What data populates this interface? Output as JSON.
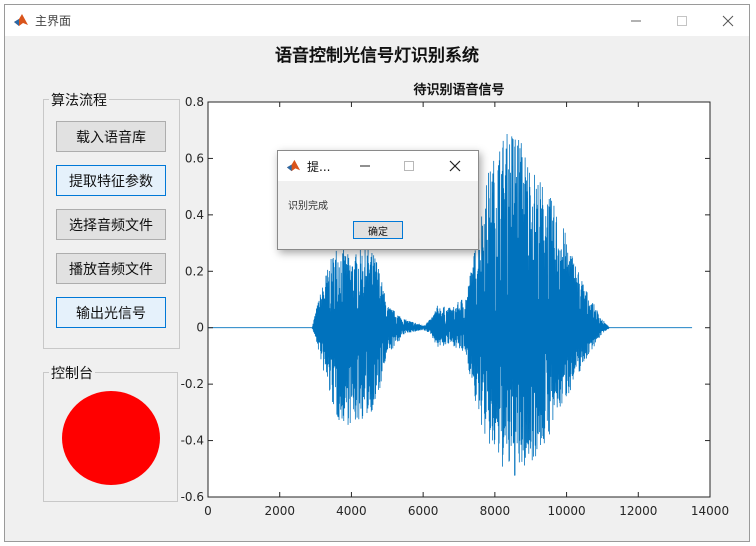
{
  "window": {
    "title": "主界面",
    "icon": "matlab-icon",
    "controls": [
      "minimize-icon",
      "maximize-icon",
      "close-icon"
    ]
  },
  "app": {
    "title": "语音控制光信号灯识别系统"
  },
  "algorithm_panel": {
    "title": "算法流程",
    "buttons": [
      {
        "label": "载入语音库",
        "highlighted": false
      },
      {
        "label": "提取特征参数",
        "highlighted": true
      },
      {
        "label": "选择音频文件",
        "highlighted": false
      },
      {
        "label": "播放音频文件",
        "highlighted": false
      },
      {
        "label": "输出光信号",
        "highlighted": true
      }
    ]
  },
  "console_panel": {
    "title": "控制台",
    "indicator_color": "#ff0000"
  },
  "dialog": {
    "title": "提...",
    "message": "识别完成",
    "ok_label": "确定"
  },
  "chart_data": {
    "type": "line",
    "title": "待识别语音信号",
    "xlabel": "",
    "ylabel": "",
    "xlim": [
      0,
      14000
    ],
    "ylim": [
      -0.6,
      0.8
    ],
    "xticks": [
      "0",
      "2000",
      "4000",
      "6000",
      "8000",
      "10000",
      "12000",
      "14000"
    ],
    "yticks": [
      "-0.6",
      "-0.4",
      "-0.2",
      "0",
      "0.2",
      "0.4",
      "0.6",
      "0.8"
    ],
    "grid": false,
    "line_color": "#0072bd",
    "series": [
      {
        "envelope_x": [
          0,
          2900,
          3000,
          3300,
          3600,
          4000,
          4400,
          4700,
          5000,
          5500,
          6000,
          6200,
          6400,
          6800,
          7200,
          7500,
          7800,
          8200,
          8600,
          9000,
          9400,
          9800,
          10200,
          10600,
          11000,
          11200,
          13500
        ],
        "envelope_max": [
          0,
          0,
          0.06,
          0.2,
          0.3,
          0.25,
          0.3,
          0.25,
          0.08,
          0.03,
          0.01,
          0.03,
          0.08,
          0.07,
          0.12,
          0.32,
          0.55,
          0.68,
          0.72,
          0.58,
          0.5,
          0.4,
          0.25,
          0.12,
          0.03,
          0.0,
          0
        ],
        "envelope_min": [
          0,
          0,
          -0.04,
          -0.2,
          -0.33,
          -0.35,
          -0.32,
          -0.28,
          -0.1,
          -0.02,
          -0.01,
          -0.02,
          -0.07,
          -0.06,
          -0.1,
          -0.3,
          -0.42,
          -0.5,
          -0.54,
          -0.48,
          -0.42,
          -0.3,
          -0.2,
          -0.1,
          -0.02,
          0.0,
          0
        ]
      }
    ]
  }
}
